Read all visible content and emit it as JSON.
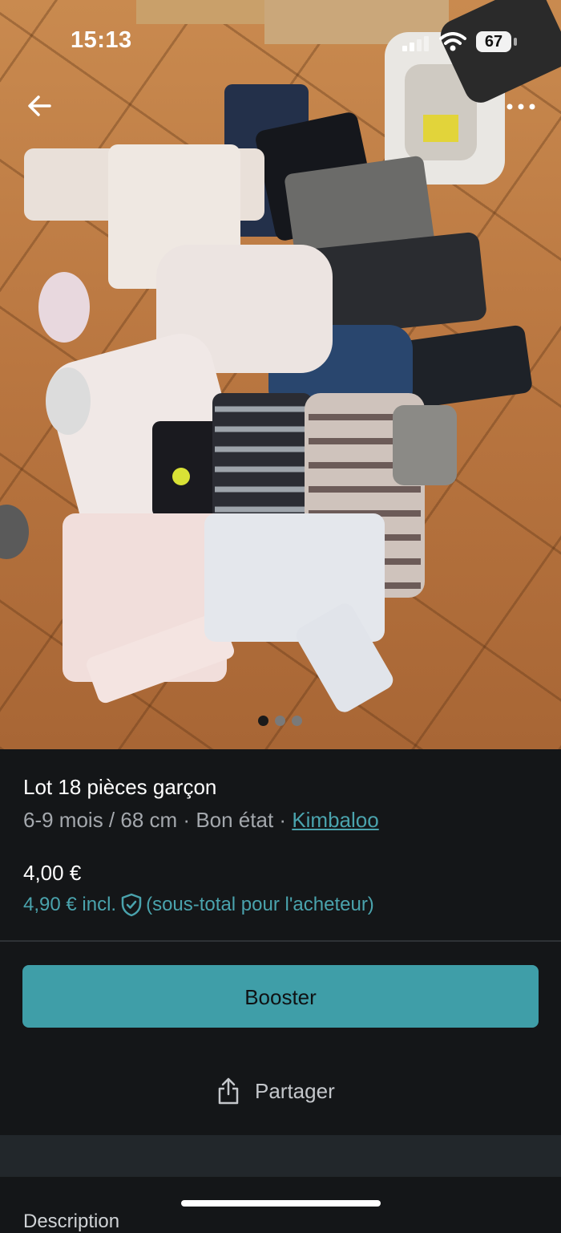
{
  "status_bar": {
    "time": "15:13",
    "battery": "67"
  },
  "gallery": {
    "total": 3,
    "active": 1
  },
  "listing": {
    "title": "Lot 18 pièces garçon",
    "size": "6-9 mois / 68 cm",
    "separator": "·",
    "condition": "Bon état",
    "brand": "Kimbaloo",
    "price": "4,00 €",
    "price_incl": "4,90 € incl.",
    "price_incl_note": "(sous-total pour l'acheteur)"
  },
  "actions": {
    "booster_label": "Booster",
    "share_label": "Partager"
  },
  "description": {
    "title": "Description"
  },
  "colors": {
    "accent": "#3f9ea8",
    "link": "#4aa3ad",
    "background": "#141618"
  }
}
